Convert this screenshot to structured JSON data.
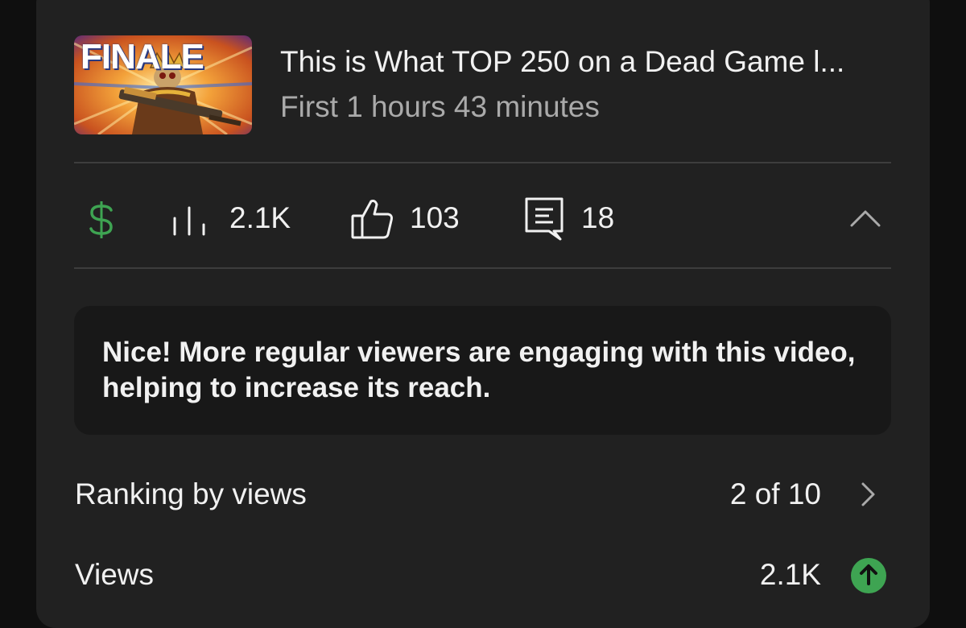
{
  "video": {
    "thumbnail_text": "FINALE",
    "title": "This is What TOP 250 on a Dead Game l...",
    "subtitle": "First 1 hours 43 minutes"
  },
  "stats": {
    "monetization_icon": "dollar-icon",
    "views_icon": "bar-chart-icon",
    "views": "2.1K",
    "likes_icon": "thumbs-up-icon",
    "likes": "103",
    "comments_icon": "comment-icon",
    "comments": "18",
    "collapse_icon": "chevron-up-icon"
  },
  "banner": {
    "message": "Nice! More regular viewers are engaging with this video, helping to increase its reach."
  },
  "rows": {
    "ranking_label": "Ranking by views",
    "ranking_value": "2 of 10",
    "views_label": "Views",
    "views_value": "2.1K"
  },
  "colors": {
    "card_bg": "#212121",
    "banner_bg": "#181818",
    "monetization_green": "#3ea452",
    "trend_up_green": "#3ea452",
    "text_primary": "#f1f1f1",
    "text_secondary": "#aaaaaa"
  }
}
